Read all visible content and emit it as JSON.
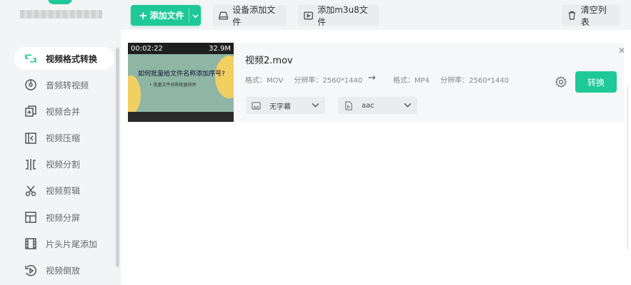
{
  "sidebar": {
    "items": [
      {
        "label": "视频格式转换",
        "icon": "convert-icon",
        "active": true
      },
      {
        "label": "音频转视频",
        "icon": "music-disc-icon"
      },
      {
        "label": "视频合并",
        "icon": "merge-icon"
      },
      {
        "label": "视频压缩",
        "icon": "compress-icon"
      },
      {
        "label": "视频分割",
        "icon": "split-icon"
      },
      {
        "label": "视频剪辑",
        "icon": "scissors-icon"
      },
      {
        "label": "视频分屏",
        "icon": "split-screen-icon"
      },
      {
        "label": "片头片尾添加",
        "icon": "film-icon"
      },
      {
        "label": "视频倒放",
        "icon": "reverse-play-icon"
      }
    ]
  },
  "toolbar": {
    "add_file_label": "添加文件",
    "device_add_label": "设备添加文件",
    "add_m3u8_label": "添加m3u8文件",
    "clear_list_label": "清空列表"
  },
  "file": {
    "name": "视频2.mov",
    "thumb_time": "00:02:22",
    "thumb_size": "32.9M",
    "thumb_headline": "如何批量给文件名称添加序号?",
    "thumb_sub": "• 批量文件名称批量排序",
    "src_format_label": "格式：",
    "src_format": "MOV",
    "src_res_label": "分辨率：",
    "src_res": "2560*1440",
    "dst_format_label": "格式：",
    "dst_format": "MP4",
    "dst_res_label": "分辨率：",
    "dst_res": "2560*1440",
    "subtitle_option": "无字幕",
    "audio_option": "aac",
    "convert_label": "转换"
  },
  "colors": {
    "accent": "#1ec997"
  }
}
